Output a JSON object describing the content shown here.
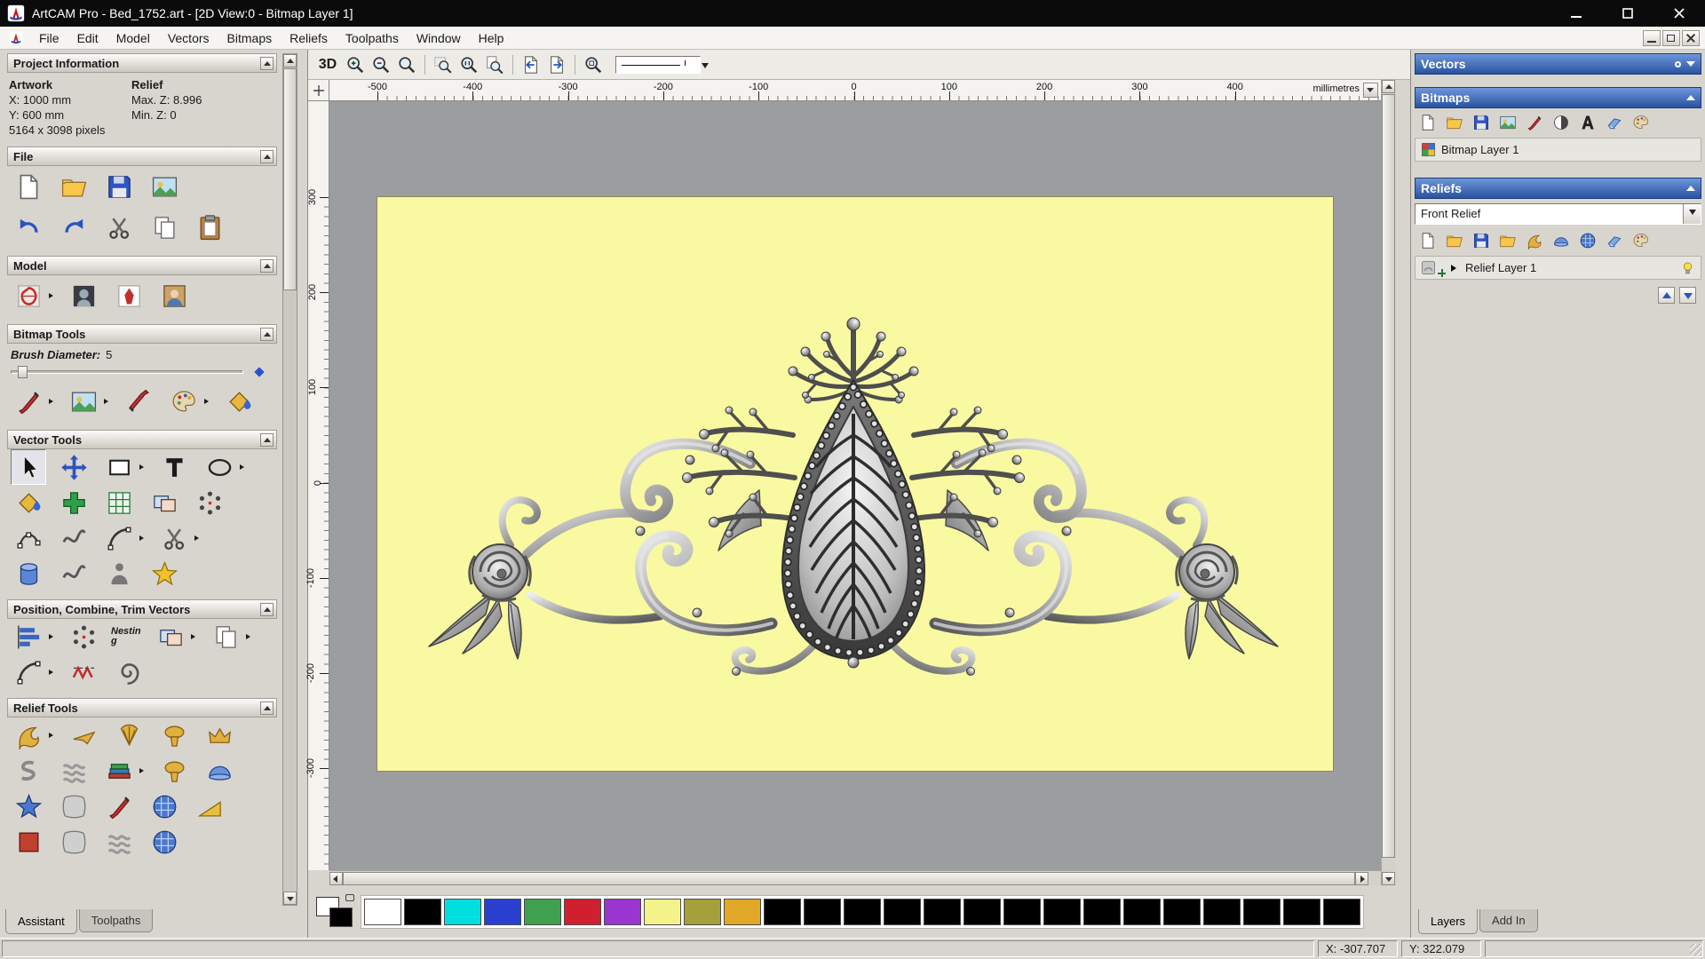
{
  "window": {
    "title": "ArtCAM Pro - Bed_1752.art - [2D View:0 - Bitmap Layer 1]"
  },
  "menu": {
    "items": [
      "File",
      "Edit",
      "Model",
      "Vectors",
      "Bitmaps",
      "Reliefs",
      "Toolpaths",
      "Window",
      "Help"
    ]
  },
  "left_panel": {
    "project_information": {
      "title": "Project Information",
      "artwork_label": "Artwork",
      "relief_label": "Relief",
      "x": "X: 1000 mm",
      "y": "Y: 600 mm",
      "max_z": "Max. Z: 8.996",
      "min_z": "Min. Z: 0",
      "pixels": "5164 x 3098 pixels"
    },
    "file_section": {
      "title": "File"
    },
    "model_section": {
      "title": "Model"
    },
    "bitmap_tools": {
      "title": "Bitmap Tools",
      "brush_diameter_label": "Brush Diameter:",
      "brush_diameter_value": "5"
    },
    "vector_tools": {
      "title": "Vector Tools"
    },
    "position_section": {
      "title": "Position, Combine, Trim Vectors",
      "nesting_label": "Nesting"
    },
    "relief_tools": {
      "title": "Relief Tools"
    },
    "tabs": [
      {
        "label": "Assistant",
        "active": true
      },
      {
        "label": "Toolpaths",
        "active": false
      }
    ]
  },
  "main_toolbar": {
    "view_3d": "3D"
  },
  "rulers": {
    "horizontal": [
      "-500",
      "-400",
      "-300",
      "-200",
      "-100",
      "0",
      "100",
      "200",
      "300",
      "400"
    ],
    "vertical": [
      "300",
      "200",
      "100",
      "0",
      "-100",
      "-200",
      "-300"
    ],
    "units": "millimetres"
  },
  "right_panel": {
    "vectors": {
      "title": "Vectors"
    },
    "bitmaps": {
      "title": "Bitmaps",
      "layer": "Bitmap Layer 1"
    },
    "reliefs": {
      "title": "Reliefs",
      "selected_relief": "Front Relief",
      "layer": "Relief Layer 1"
    },
    "tabs": [
      {
        "label": "Layers",
        "active": true
      },
      {
        "label": "Add In",
        "active": false
      }
    ]
  },
  "palette": {
    "colors": [
      "#ffffff",
      "#000000",
      "#00dfe0",
      "#2a3fd0",
      "#3fa050",
      "#d02030",
      "#9b35cf",
      "#f3f38a",
      "#a6a03a",
      "#e0a826",
      "#000000",
      "#000000",
      "#000000",
      "#000000",
      "#000000",
      "#000000",
      "#000000",
      "#000000",
      "#000000",
      "#000000",
      "#000000",
      "#000000",
      "#000000",
      "#000000",
      "#000000"
    ]
  },
  "status_bar": {
    "x": "X: -307.707",
    "y": "Y: 322.079"
  }
}
